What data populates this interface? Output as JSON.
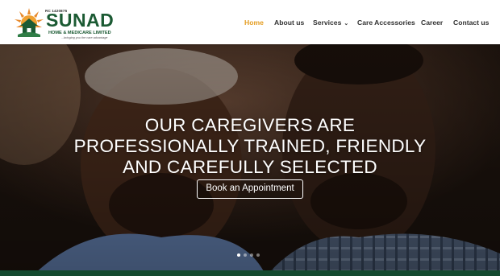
{
  "logo": {
    "rc_number": "RC 1420875",
    "name": "SUNAD",
    "subtitle": "HOME & MEDICARE LIMITED",
    "tagline": "...bringing you the care advantage",
    "icon": "house-sun-logo-icon",
    "brand_green": "#1b5a33",
    "brand_orange": "#e8892b"
  },
  "nav": {
    "items": [
      {
        "label": "Home",
        "active": true
      },
      {
        "label": "About us",
        "active": false
      },
      {
        "label": "Services",
        "active": false,
        "has_dropdown": true,
        "dropdown_icon": "chevron-down-icon"
      },
      {
        "label": "Care Accessories",
        "active": false
      },
      {
        "label": "Career",
        "active": false
      },
      {
        "label": "Contact us",
        "active": false
      }
    ],
    "active_color": "#e49d22",
    "text_color": "#333333"
  },
  "hero": {
    "headline_lines": [
      "OUR CAREGIVERS ARE",
      "PROFESSIONALLY TRAINED, FRIENDLY",
      "AND CAREFULLY SELECTED"
    ],
    "cta_label": "Book an Appointment",
    "slide_count": 4,
    "active_slide": 1,
    "image_subject": "smiling elderly man and younger man",
    "footer_band_color": "#134a2f"
  }
}
